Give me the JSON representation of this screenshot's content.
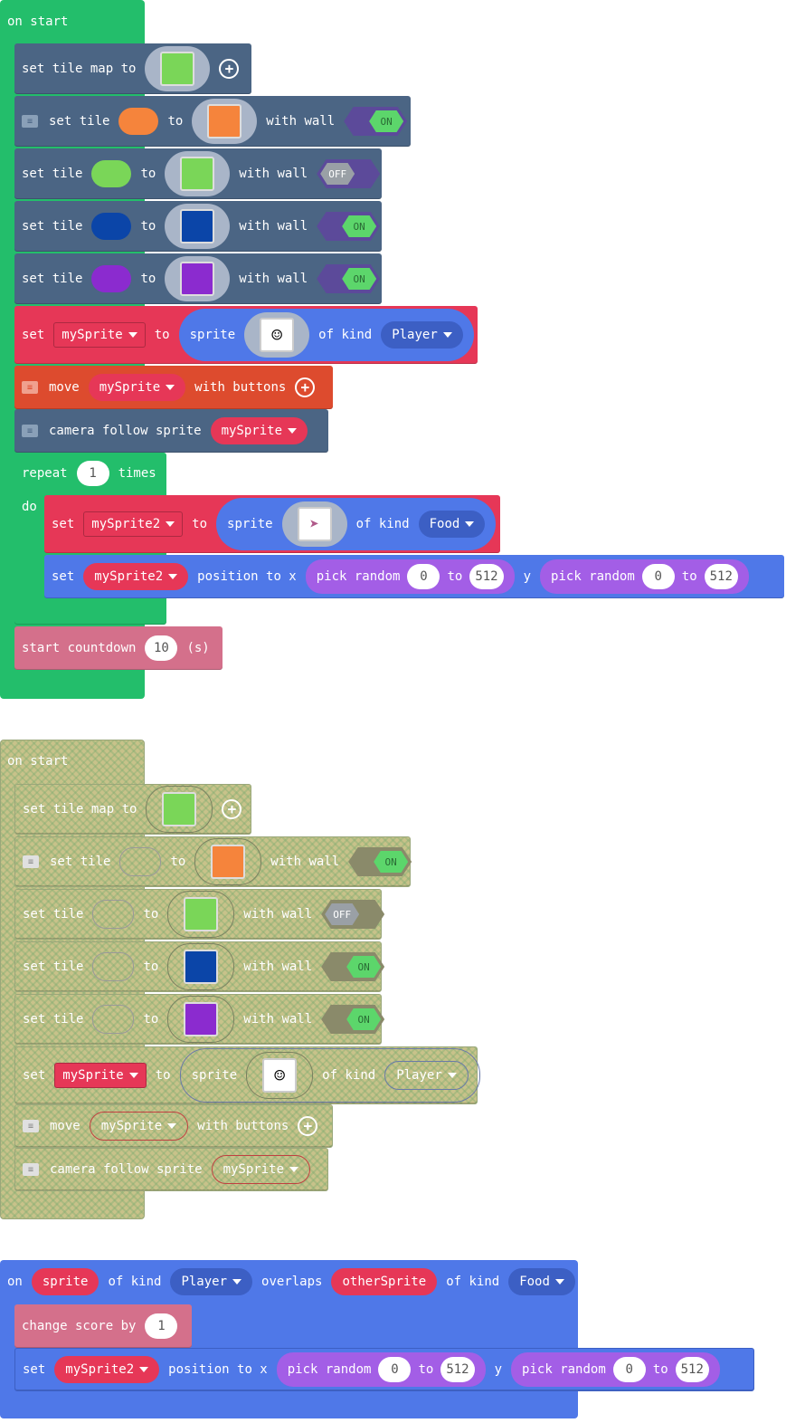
{
  "script1": {
    "hat": "on start",
    "tilemap": {
      "label": "set tile map to"
    },
    "tiles": [
      {
        "set": "set tile",
        "to": "to",
        "wall": "with wall",
        "toggle": "ON",
        "color": "#f5843c"
      },
      {
        "set": "set tile",
        "to": "to",
        "wall": "with wall",
        "toggle": "OFF",
        "color": "#7ad658"
      },
      {
        "set": "set tile",
        "to": "to",
        "wall": "with wall",
        "toggle": "ON",
        "color": "#0b45a8"
      },
      {
        "set": "set tile",
        "to": "to",
        "wall": "with wall",
        "toggle": "ON",
        "color": "#8b2bcf"
      }
    ],
    "setsprite": {
      "set": "set",
      "var": "mySprite",
      "to": "to",
      "sprite": "sprite",
      "ofkind": "of kind",
      "kind": "Player"
    },
    "move": {
      "move": "move",
      "var": "mySprite",
      "with": "with buttons"
    },
    "camera": {
      "label": "camera follow sprite",
      "var": "mySprite"
    },
    "repeat": {
      "label": "repeat",
      "count": "1",
      "times": "times",
      "do": "do"
    },
    "setsprite2": {
      "set": "set",
      "var": "mySprite2",
      "to": "to",
      "sprite": "sprite",
      "ofkind": "of kind",
      "kind": "Food"
    },
    "position": {
      "set": "set",
      "var": "mySprite2",
      "posx": "position to x",
      "pick": "pick random",
      "a": "0",
      "to": "to",
      "b": "512",
      "y": "y",
      "pick2": "pick random",
      "c": "0",
      "to2": "to",
      "d": "512"
    },
    "countdown": {
      "label": "start countdown",
      "value": "10",
      "unit": "(s)"
    }
  },
  "script2": {
    "hat": "on start",
    "tilemap": {
      "label": "set tile map to"
    },
    "tiles": [
      {
        "set": "set tile",
        "to": "to",
        "wall": "with wall",
        "toggle": "ON"
      },
      {
        "set": "set tile",
        "to": "to",
        "wall": "with wall",
        "toggle": "OFF"
      },
      {
        "set": "set tile",
        "to": "to",
        "wall": "with wall",
        "toggle": "ON"
      },
      {
        "set": "set tile",
        "to": "to",
        "wall": "with wall",
        "toggle": "ON"
      }
    ],
    "setsprite": {
      "set": "set",
      "var": "mySprite",
      "to": "to",
      "sprite": "sprite",
      "ofkind": "of kind",
      "kind": "Player"
    },
    "move": {
      "move": "move",
      "var": "mySprite",
      "with": "with buttons"
    },
    "camera": {
      "label": "camera follow sprite",
      "var": "mySprite"
    }
  },
  "script3": {
    "on": "on",
    "sprite": "sprite",
    "ofkind": "of kind",
    "kind": "Player",
    "overlaps": "overlaps",
    "other": "otherSprite",
    "ofkind2": "of kind",
    "kind2": "Food",
    "score": {
      "label": "change score by",
      "value": "1"
    },
    "position": {
      "set": "set",
      "var": "mySprite2",
      "posx": "position to x",
      "pick": "pick random",
      "a": "0",
      "to": "to",
      "b": "512",
      "y": "y",
      "pick2": "pick random",
      "c": "0",
      "to2": "to",
      "d": "512"
    }
  },
  "colors": {
    "events": "#23be6b",
    "scene": "#4b6584",
    "sprites": "#4f78e8",
    "variables": "#e63757",
    "controller": "#dd4b2e",
    "math": "#a35ee6",
    "info": "#d4708b",
    "sprite_events": "#4f78e8"
  }
}
